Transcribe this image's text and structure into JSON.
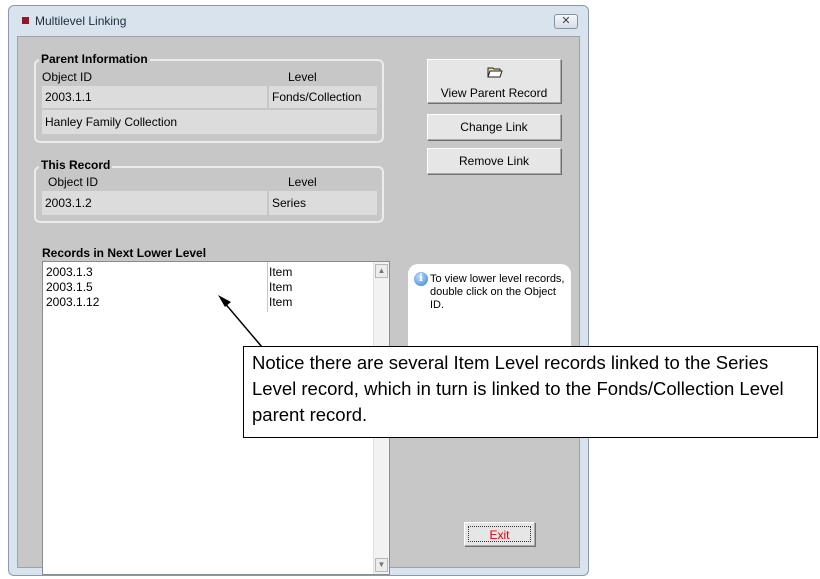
{
  "window": {
    "title": "Multilevel Linking",
    "close_symbol": "✕",
    "close_icon": "close-icon"
  },
  "parent_info": {
    "heading": "Parent Information",
    "object_id_label": "Object ID",
    "level_label": "Level",
    "object_id": "2003.1.1",
    "level": "Fonds/Collection",
    "name": "Hanley Family Collection"
  },
  "this_record": {
    "heading": "This Record",
    "object_id_label": "Object ID",
    "level_label": "Level",
    "object_id": "2003.1.2",
    "level": "Series"
  },
  "buttons": {
    "view_parent": "View Parent Record",
    "view_parent_icon": "folder-open-icon",
    "change_link": "Change Link",
    "remove_link": "Remove Link",
    "exit": "Exit"
  },
  "lower_level": {
    "heading": "Records in Next Lower Level",
    "rows": [
      {
        "object_id": "2003.1.3",
        "level": "Item"
      },
      {
        "object_id": "2003.1.5",
        "level": "Item"
      },
      {
        "object_id": "2003.1.12",
        "level": "Item"
      }
    ]
  },
  "info": {
    "icon": "info-icon",
    "text": "To view lower level records, double click on the Object ID."
  },
  "callout": {
    "text": "Notice there are several Item Level records linked to the Series Level record, which in turn is linked to the Fonds/Collection Level parent record."
  },
  "colors": {
    "panel": "#c7c7c7",
    "field": "#dcdcdc",
    "exit_text": "#e00000"
  }
}
